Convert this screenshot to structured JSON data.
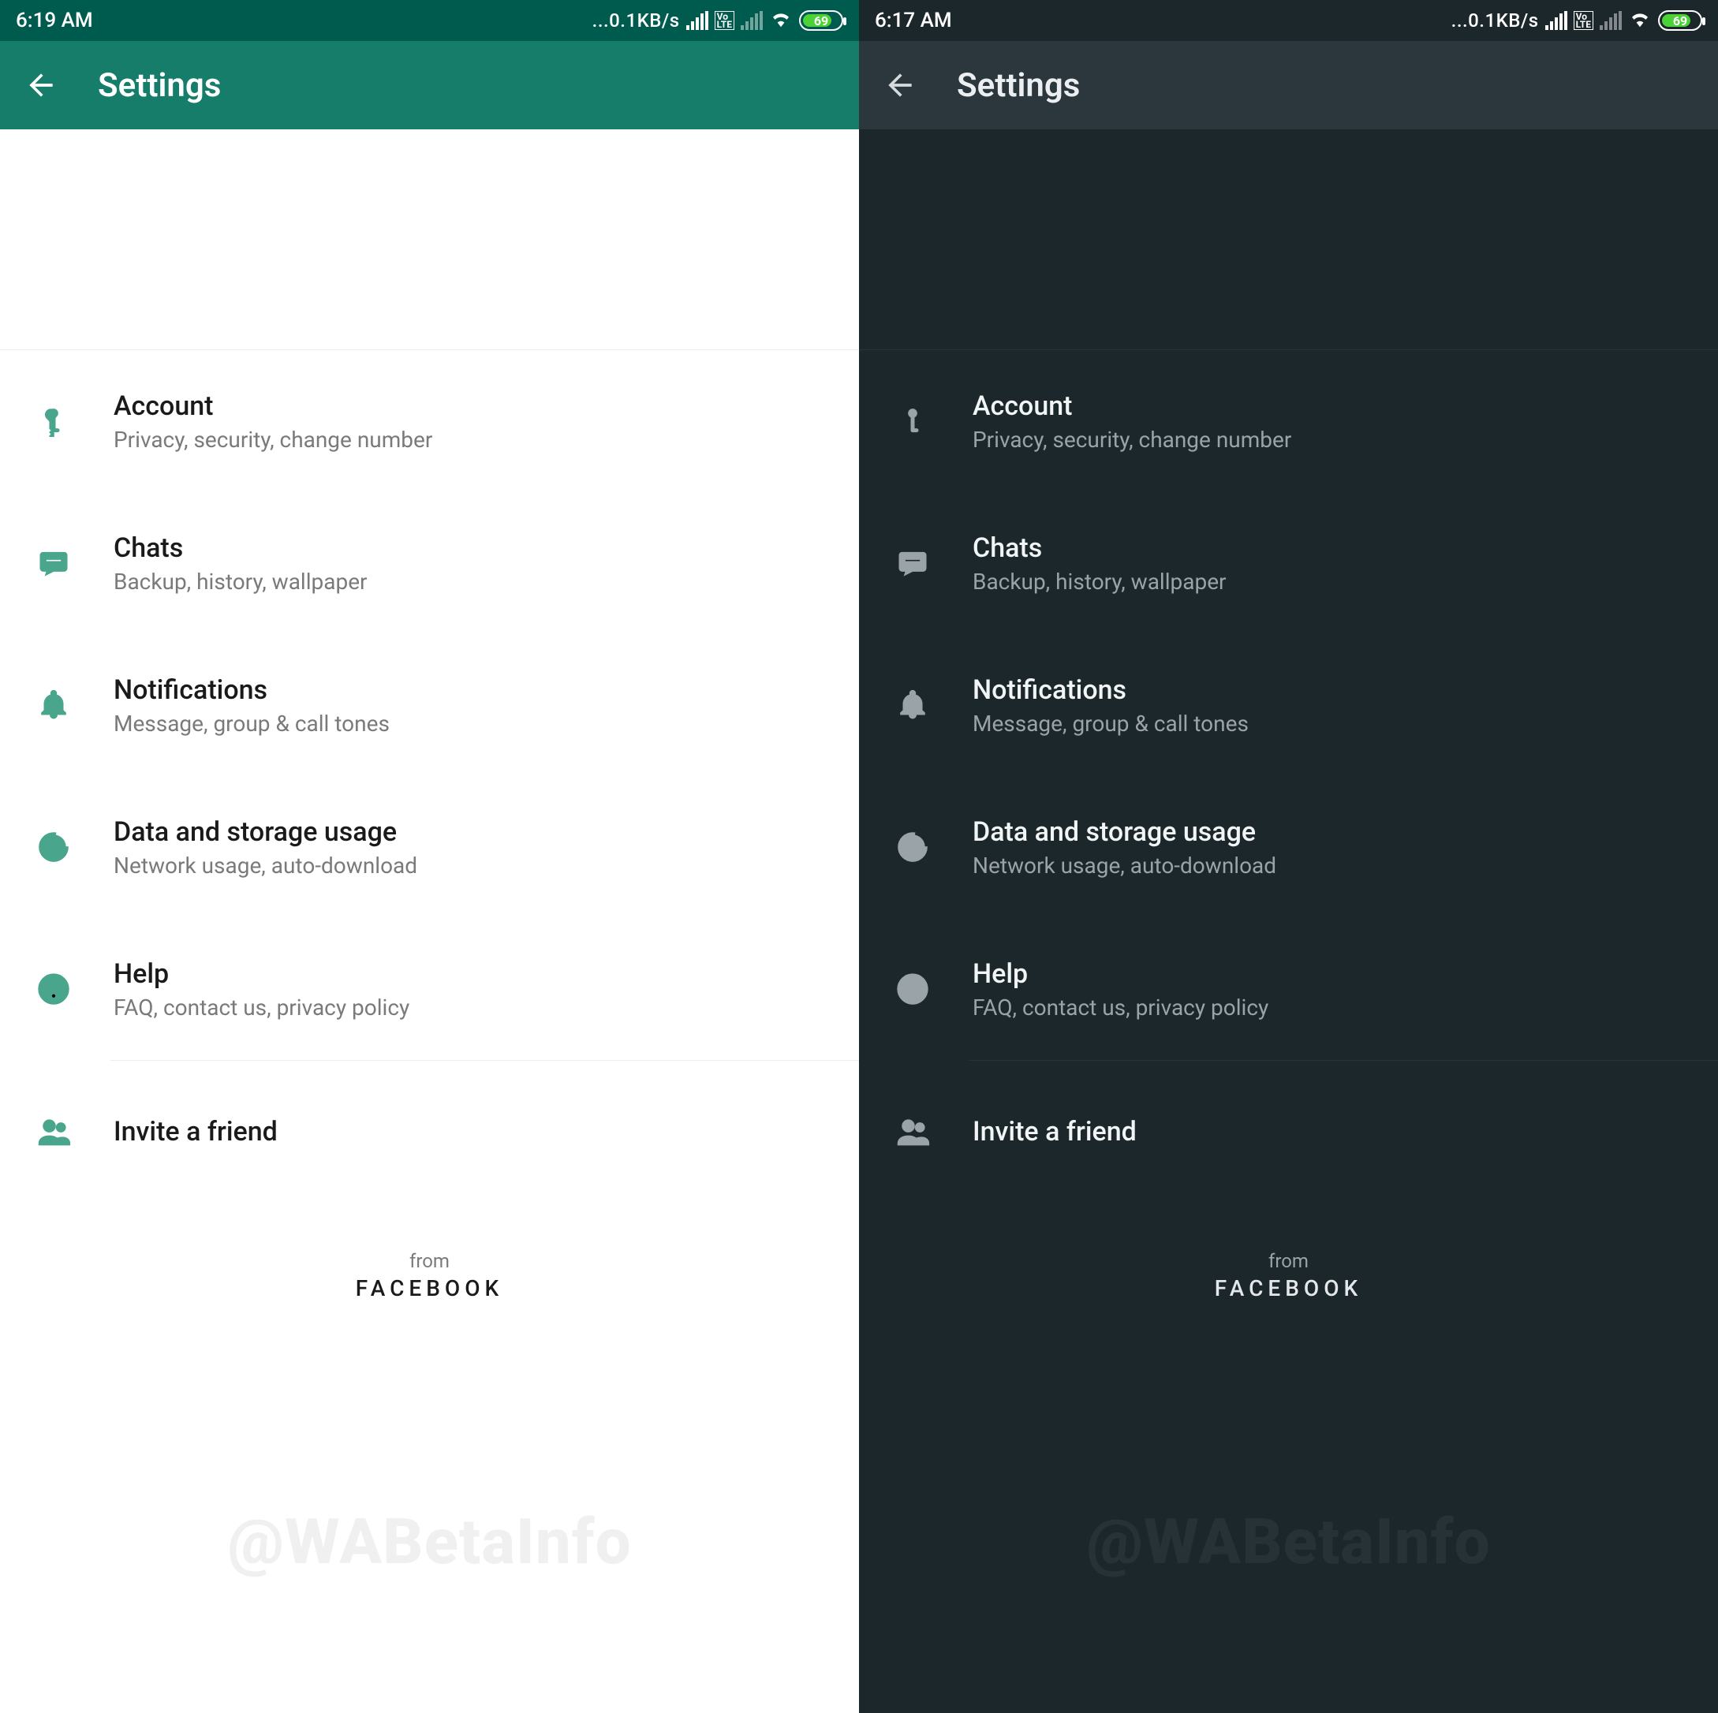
{
  "light": {
    "status": {
      "time": "6:19 AM",
      "speed": "...0.1KB/s",
      "battery_pct": "69",
      "battery_fill_pct": 69
    },
    "appbar": {
      "title": "Settings"
    },
    "items": [
      {
        "title": "Account",
        "subtitle": "Privacy, security, change number"
      },
      {
        "title": "Chats",
        "subtitle": "Backup, history, wallpaper"
      },
      {
        "title": "Notifications",
        "subtitle": "Message, group & call tones"
      },
      {
        "title": "Data and storage usage",
        "subtitle": "Network usage, auto-download"
      },
      {
        "title": "Help",
        "subtitle": "FAQ, contact us, privacy policy"
      }
    ],
    "invite": {
      "title": "Invite a friend"
    },
    "footer": {
      "from": "from",
      "brand": "FACEBOOK"
    },
    "watermark": "@WABetaInfo"
  },
  "dark": {
    "status": {
      "time": "6:17 AM",
      "speed": "...0.1KB/s",
      "battery_pct": "69",
      "battery_fill_pct": 69
    },
    "appbar": {
      "title": "Settings"
    },
    "items": [
      {
        "title": "Account",
        "subtitle": "Privacy, security, change number"
      },
      {
        "title": "Chats",
        "subtitle": "Backup, history, wallpaper"
      },
      {
        "title": "Notifications",
        "subtitle": "Message, group & call tones"
      },
      {
        "title": "Data and storage usage",
        "subtitle": "Network usage, auto-download"
      },
      {
        "title": "Help",
        "subtitle": "FAQ, contact us, privacy policy"
      }
    ],
    "invite": {
      "title": "Invite a friend"
    },
    "footer": {
      "from": "from",
      "brand": "FACEBOOK"
    },
    "watermark": "@WABetaInfo"
  }
}
